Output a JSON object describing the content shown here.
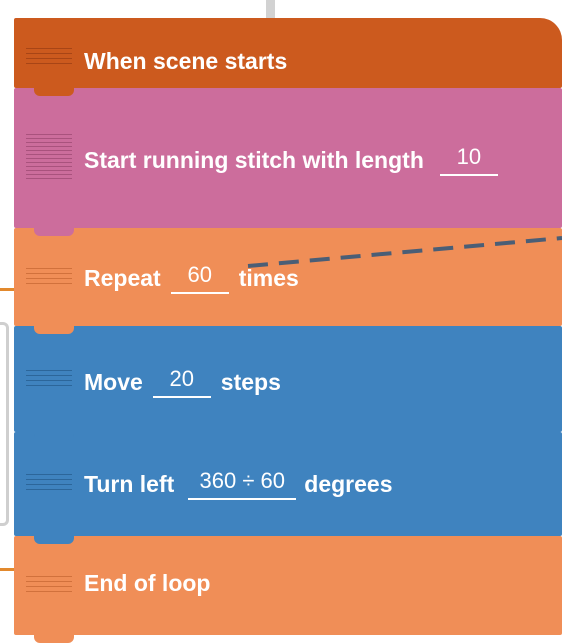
{
  "blocks": {
    "start": {
      "label": "When scene starts"
    },
    "stitch": {
      "label": "Start running stitch with length",
      "value": "10"
    },
    "repeat": {
      "label": "Repeat",
      "value": "60",
      "suffix": "times"
    },
    "move": {
      "label": "Move",
      "value": "20",
      "suffix": "steps"
    },
    "turn": {
      "label": "Turn left",
      "value": "360 ÷ 60",
      "suffix": "degrees"
    },
    "end": {
      "label": "End of loop"
    }
  },
  "colors": {
    "start": "#cc5a1e",
    "stitch": "#cc6d9c",
    "loop": "#f08e57",
    "motion": "#3f83bf",
    "connector": "#4a5e76"
  }
}
